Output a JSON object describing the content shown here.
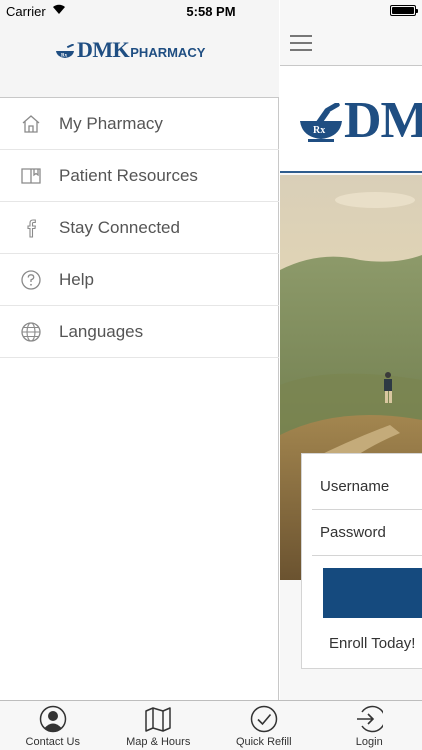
{
  "status_bar": {
    "carrier": "Carrier",
    "time": "5:58 PM"
  },
  "drawer": {
    "logo": {
      "brand": "DMK",
      "suffix": "PHARMACY",
      "badge": "Rx"
    },
    "menu_items": [
      {
        "label": "My Pharmacy",
        "icon": "home-icon"
      },
      {
        "label": "Patient Resources",
        "icon": "book-icon"
      },
      {
        "label": "Stay Connected",
        "icon": "facebook-icon"
      },
      {
        "label": "Help",
        "icon": "help-icon"
      },
      {
        "label": "Languages",
        "icon": "globe-icon"
      }
    ]
  },
  "main": {
    "banner_logo": {
      "brand": "DM",
      "badge": "Rx"
    },
    "login": {
      "username_placeholder": "Username",
      "password_placeholder": "Password",
      "login_button_label": "",
      "enroll_link": "Enroll Today!"
    }
  },
  "tab_bar": {
    "tabs": [
      {
        "label": "Contact Us",
        "icon": "contact-icon"
      },
      {
        "label": "Map & Hours",
        "icon": "map-icon"
      },
      {
        "label": "Quick Refill",
        "icon": "checkmark-icon"
      },
      {
        "label": "Login",
        "icon": "login-icon"
      }
    ]
  },
  "colors": {
    "brand_blue": "#1f4e82",
    "button_blue": "#154a7e",
    "drawer_header_bg": "#f5f5f5",
    "tab_bar_bg": "#f7f7f7"
  }
}
